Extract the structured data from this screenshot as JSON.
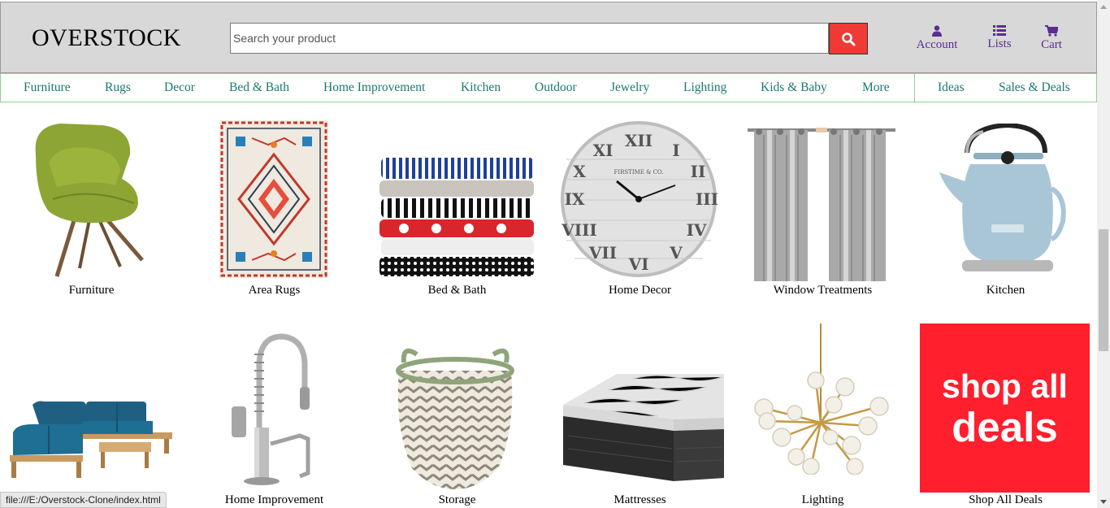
{
  "header": {
    "logo": "OVERSTOCK",
    "search_placeholder": "Search your product",
    "account_label": "Account",
    "lists_label": "Lists",
    "cart_label": "Cart"
  },
  "nav": {
    "items": [
      "Furniture",
      "Rugs",
      "Decor",
      "Bed & Bath",
      "Home Improvement",
      "Kitchen",
      "Outdoor",
      "Jewelry",
      "Lighting",
      "Kids & Baby",
      "More"
    ],
    "extra": [
      "Ideas",
      "Sales & Deals"
    ]
  },
  "tiles": {
    "row1": [
      "Furniture",
      "Area Rugs",
      "Bed & Bath",
      "Home Decor",
      "Window Treatments",
      "Kitchen"
    ],
    "row2": [
      "",
      "Home Improvement",
      "Storage",
      "Mattresses",
      "Lighting",
      "Shop All Deals"
    ]
  },
  "promo": {
    "line1": "shop all",
    "line2": "deals"
  },
  "status": {
    "url": "file:///E:/Overstock-Clone/index.html"
  },
  "colors": {
    "accent": "#ef3a35",
    "nav_text": "#1a7a6e",
    "header_links": "#5a2d91",
    "promo_bg": "#ff1f2d"
  },
  "icons": [
    "search-icon",
    "account-icon",
    "lists-icon",
    "cart-icon"
  ]
}
